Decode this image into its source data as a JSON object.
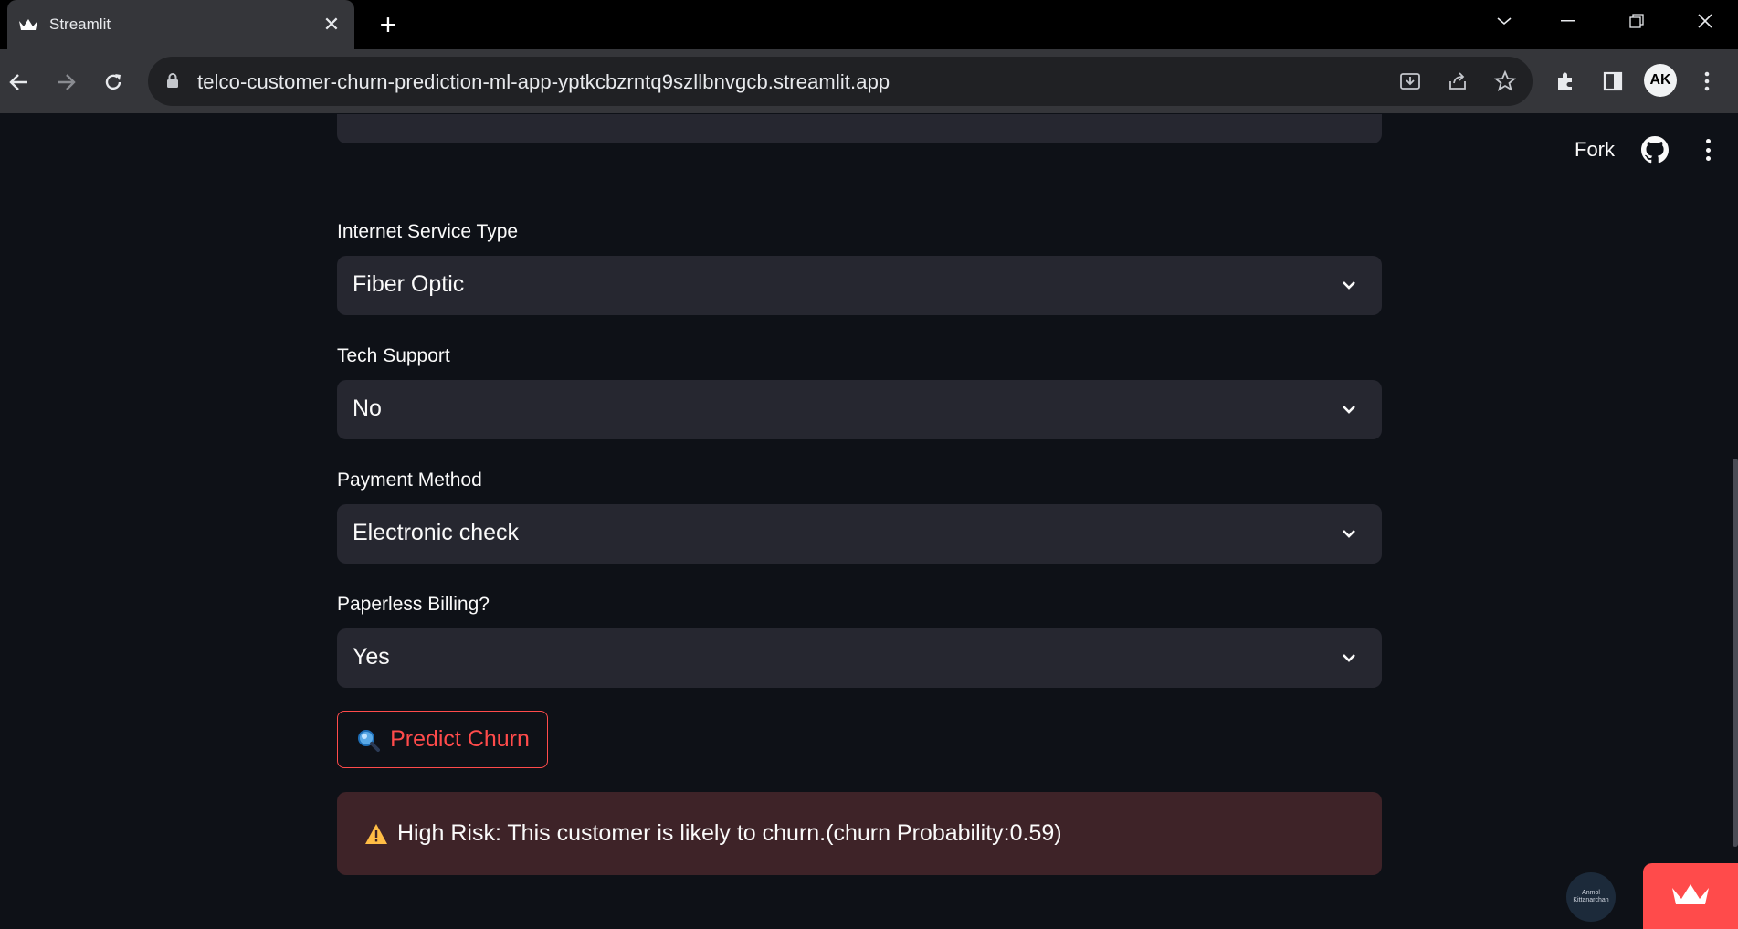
{
  "browser": {
    "tab_title": "Streamlit",
    "url": "telco-customer-churn-prediction-ml-app-yptkcbzrntq9szllbnvgcb.streamlit.app",
    "profile_initials": "AK"
  },
  "header": {
    "fork_label": "Fork"
  },
  "form": {
    "fields": [
      {
        "label": "Internet Service Type",
        "value": "Fiber Optic"
      },
      {
        "label": "Tech Support",
        "value": "No"
      },
      {
        "label": "Payment Method",
        "value": "Electronic check"
      },
      {
        "label": "Paperless Billing?",
        "value": "Yes"
      }
    ],
    "predict_button": {
      "icon": "magnifier-icon",
      "label": "Predict Churn"
    }
  },
  "result": {
    "icon": "warning-icon",
    "message": "High Risk: This customer is likely to churn.(churn Probability:0.59)"
  },
  "badge": {
    "text_line1": "Anmol",
    "text_line2": "Kittanarchan"
  },
  "colors": {
    "primary": "#ff4b4b",
    "background": "#0e1117",
    "widget_bg": "#262730",
    "alert_bg": "#3e2328"
  }
}
